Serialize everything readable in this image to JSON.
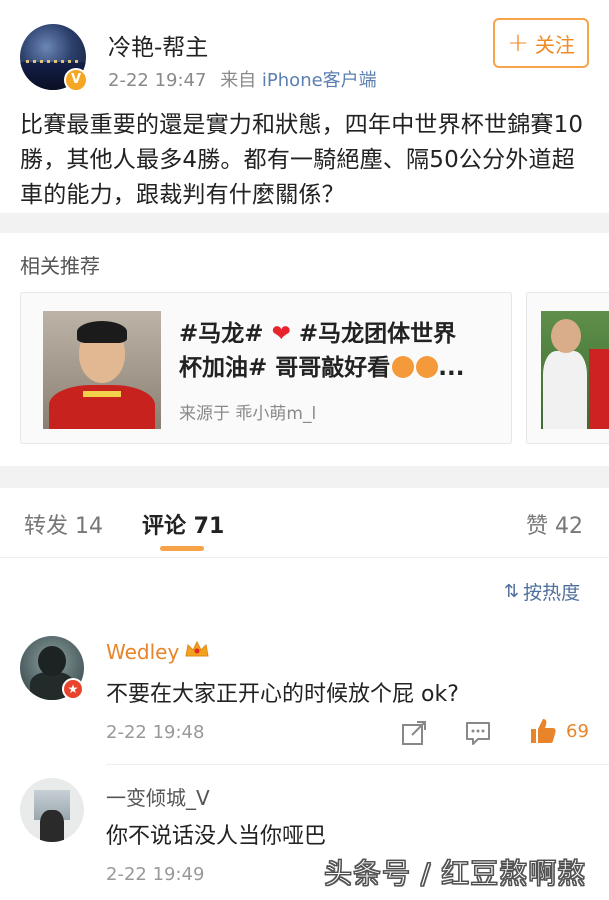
{
  "post": {
    "author": "冷艳-帮主",
    "vip_badge": "V",
    "time": "2-22 19:47",
    "source_prefix": "来自",
    "source": "iPhone客户端",
    "follow_label": "关注",
    "body": "比賽最重要的還是實力和狀態，四年中世界杯世錦賽10勝，其他人最多4勝。都有一騎絕塵、隔50公分外道超車的能力，跟裁判有什麼關係？"
  },
  "recommend": {
    "title": "相关推荐",
    "card": {
      "line1_a": "#马龙#",
      "line1_b": "#马龙团体世界",
      "line2": "杯加油# 哥哥敲好看",
      "ellipsis": "...",
      "source": "来源于 乖小萌m_l"
    }
  },
  "tabs": {
    "repost": "转发 14",
    "comment": "评论 71",
    "like": "赞 42"
  },
  "sort_label": "按热度",
  "comments": [
    {
      "name": "Wedley",
      "text": "不要在大家正开心的时候放个屁 ok?",
      "time": "2-22 19:48",
      "likes": "69"
    },
    {
      "name": "一变倾城_V",
      "text": "你不说话没人当你哑巴",
      "time": "2-22 19:49"
    }
  ],
  "watermark": "头条号 / 红豆熬啊熬",
  "colors": {
    "accent": "#f7a34a",
    "link": "#5b7fb0",
    "like": "#e8842a"
  }
}
